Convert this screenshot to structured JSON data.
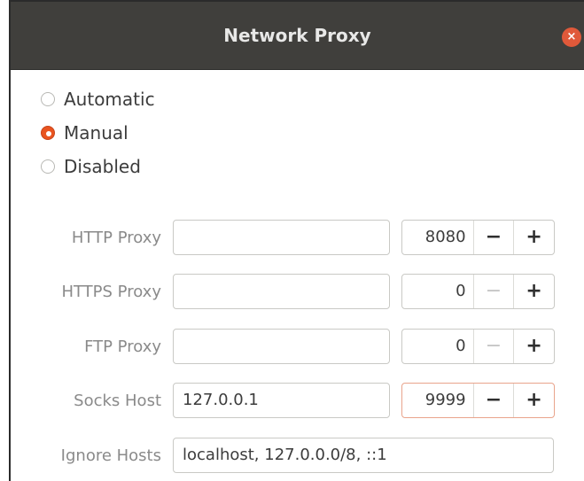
{
  "window": {
    "title": "Network Proxy",
    "close_glyph": "×"
  },
  "modes": [
    {
      "label": "Automatic",
      "checked": false
    },
    {
      "label": "Manual",
      "checked": true
    },
    {
      "label": "Disabled",
      "checked": false
    }
  ],
  "proxies": [
    {
      "label": "HTTP Proxy",
      "host": "",
      "port": "8080",
      "minus_enabled": true
    },
    {
      "label": "HTTPS Proxy",
      "host": "",
      "port": "0",
      "minus_enabled": false
    },
    {
      "label": "FTP Proxy",
      "host": "",
      "port": "0",
      "minus_enabled": false
    },
    {
      "label": "Socks Host",
      "host": "127.0.0.1",
      "port": "9999",
      "minus_enabled": true
    }
  ],
  "ignore_hosts": {
    "label": "Ignore Hosts",
    "value": "localhost, 127.0.0.0/8, ::1"
  },
  "spin_glyphs": {
    "minus": "−",
    "plus": "+"
  },
  "colors": {
    "accent": "#e95420",
    "titlebar": "#403f3c"
  }
}
